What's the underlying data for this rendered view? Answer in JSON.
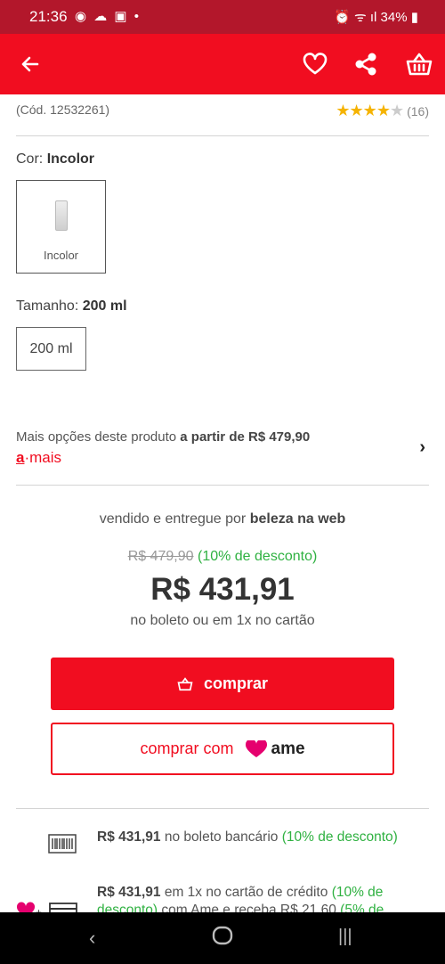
{
  "status": {
    "time": "21:36",
    "battery": "34%"
  },
  "product": {
    "code": "(Cód. 12532261)",
    "review_count": "(16)",
    "rating_stars": 4,
    "color_label": "Cor:",
    "color_value": "Incolor",
    "swatch_label": "Incolor",
    "size_label": "Tamanho:",
    "size_value": "200 ml",
    "size_option": "200 ml"
  },
  "more_options": {
    "text": "Mais opções deste produto",
    "price_text": "a partir de R$ 479,90",
    "brand_prefix": "a",
    "brand_suffix": "·mais"
  },
  "seller": {
    "text": "vendido e entregue por",
    "name": "beleza na web"
  },
  "pricing": {
    "old_price": "R$ 479,90",
    "discount": "(10% de desconto)",
    "price": "R$ 431,91",
    "condition": "no boleto ou em 1x no cartão"
  },
  "buttons": {
    "buy": "comprar",
    "buy_with": "comprar com",
    "ame": "ame"
  },
  "payments": [
    {
      "amount": "R$ 431,91",
      "text": "no boleto bancário",
      "discount": "(10% de desconto)"
    },
    {
      "amount": "R$ 431,91",
      "text": "em 1x no cartão de crédito",
      "discount": "(10% de desconto)",
      "extra": "com Ame e receba R$ 21,60",
      "cashback": "(5% de"
    }
  ],
  "colors": {
    "brand": "#f10d20",
    "statusbar": "#b3172b",
    "green": "#2fb141",
    "star": "#f5b301"
  }
}
